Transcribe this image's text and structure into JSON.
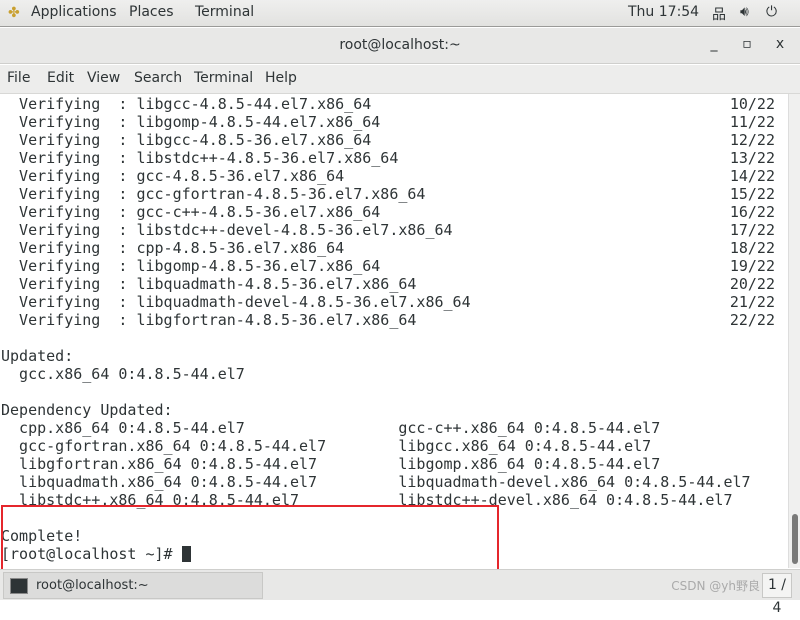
{
  "topbar": {
    "applications": "Applications",
    "places": "Places",
    "terminal": "Terminal",
    "clock": "Thu 17:54"
  },
  "window": {
    "title": "root@localhost:~",
    "minimize": "_",
    "maximize": "▫",
    "close": "x"
  },
  "menu": [
    "File",
    "Edit",
    "View",
    "Search",
    "Terminal",
    "Help"
  ],
  "verifying": [
    {
      "text": "  Verifying  : libgcc-4.8.5-44.el7.x86_64",
      "count": "10/22"
    },
    {
      "text": "  Verifying  : libgomp-4.8.5-44.el7.x86_64",
      "count": "11/22"
    },
    {
      "text": "  Verifying  : libgcc-4.8.5-36.el7.x86_64",
      "count": "12/22"
    },
    {
      "text": "  Verifying  : libstdc++-4.8.5-36.el7.x86_64",
      "count": "13/22"
    },
    {
      "text": "  Verifying  : gcc-4.8.5-36.el7.x86_64",
      "count": "14/22"
    },
    {
      "text": "  Verifying  : gcc-gfortran-4.8.5-36.el7.x86_64",
      "count": "15/22"
    },
    {
      "text": "  Verifying  : gcc-c++-4.8.5-36.el7.x86_64",
      "count": "16/22"
    },
    {
      "text": "  Verifying  : libstdc++-devel-4.8.5-36.el7.x86_64",
      "count": "17/22"
    },
    {
      "text": "  Verifying  : cpp-4.8.5-36.el7.x86_64",
      "count": "18/22"
    },
    {
      "text": "  Verifying  : libgomp-4.8.5-36.el7.x86_64",
      "count": "19/22"
    },
    {
      "text": "  Verifying  : libquadmath-4.8.5-36.el7.x86_64",
      "count": "20/22"
    },
    {
      "text": "  Verifying  : libquadmath-devel-4.8.5-36.el7.x86_64",
      "count": "21/22"
    },
    {
      "text": "  Verifying  : libgfortran-4.8.5-36.el7.x86_64",
      "count": "22/22"
    }
  ],
  "output": [
    "",
    "Updated:",
    "  gcc.x86_64 0:4.8.5-44.el7",
    "",
    "Dependency Updated:",
    "  cpp.x86_64 0:4.8.5-44.el7                 gcc-c++.x86_64 0:4.8.5-44.el7",
    "  gcc-gfortran.x86_64 0:4.8.5-44.el7        libgcc.x86_64 0:4.8.5-44.el7",
    "  libgfortran.x86_64 0:4.8.5-44.el7         libgomp.x86_64 0:4.8.5-44.el7",
    "  libquadmath.x86_64 0:4.8.5-44.el7         libquadmath-devel.x86_64 0:4.8.5-44.el7",
    "  libstdc++.x86_64 0:4.8.5-44.el7           libstdc++-devel.x86_64 0:4.8.5-44.el7",
    "",
    "Complete!"
  ],
  "prompt": "[root@localhost ~]# ",
  "taskbar": {
    "task": "root@localhost:~",
    "watermark": "CSDN @yh野良",
    "workspace": "1 / 4"
  },
  "colors": {
    "highlight_box": "#e5262c"
  }
}
